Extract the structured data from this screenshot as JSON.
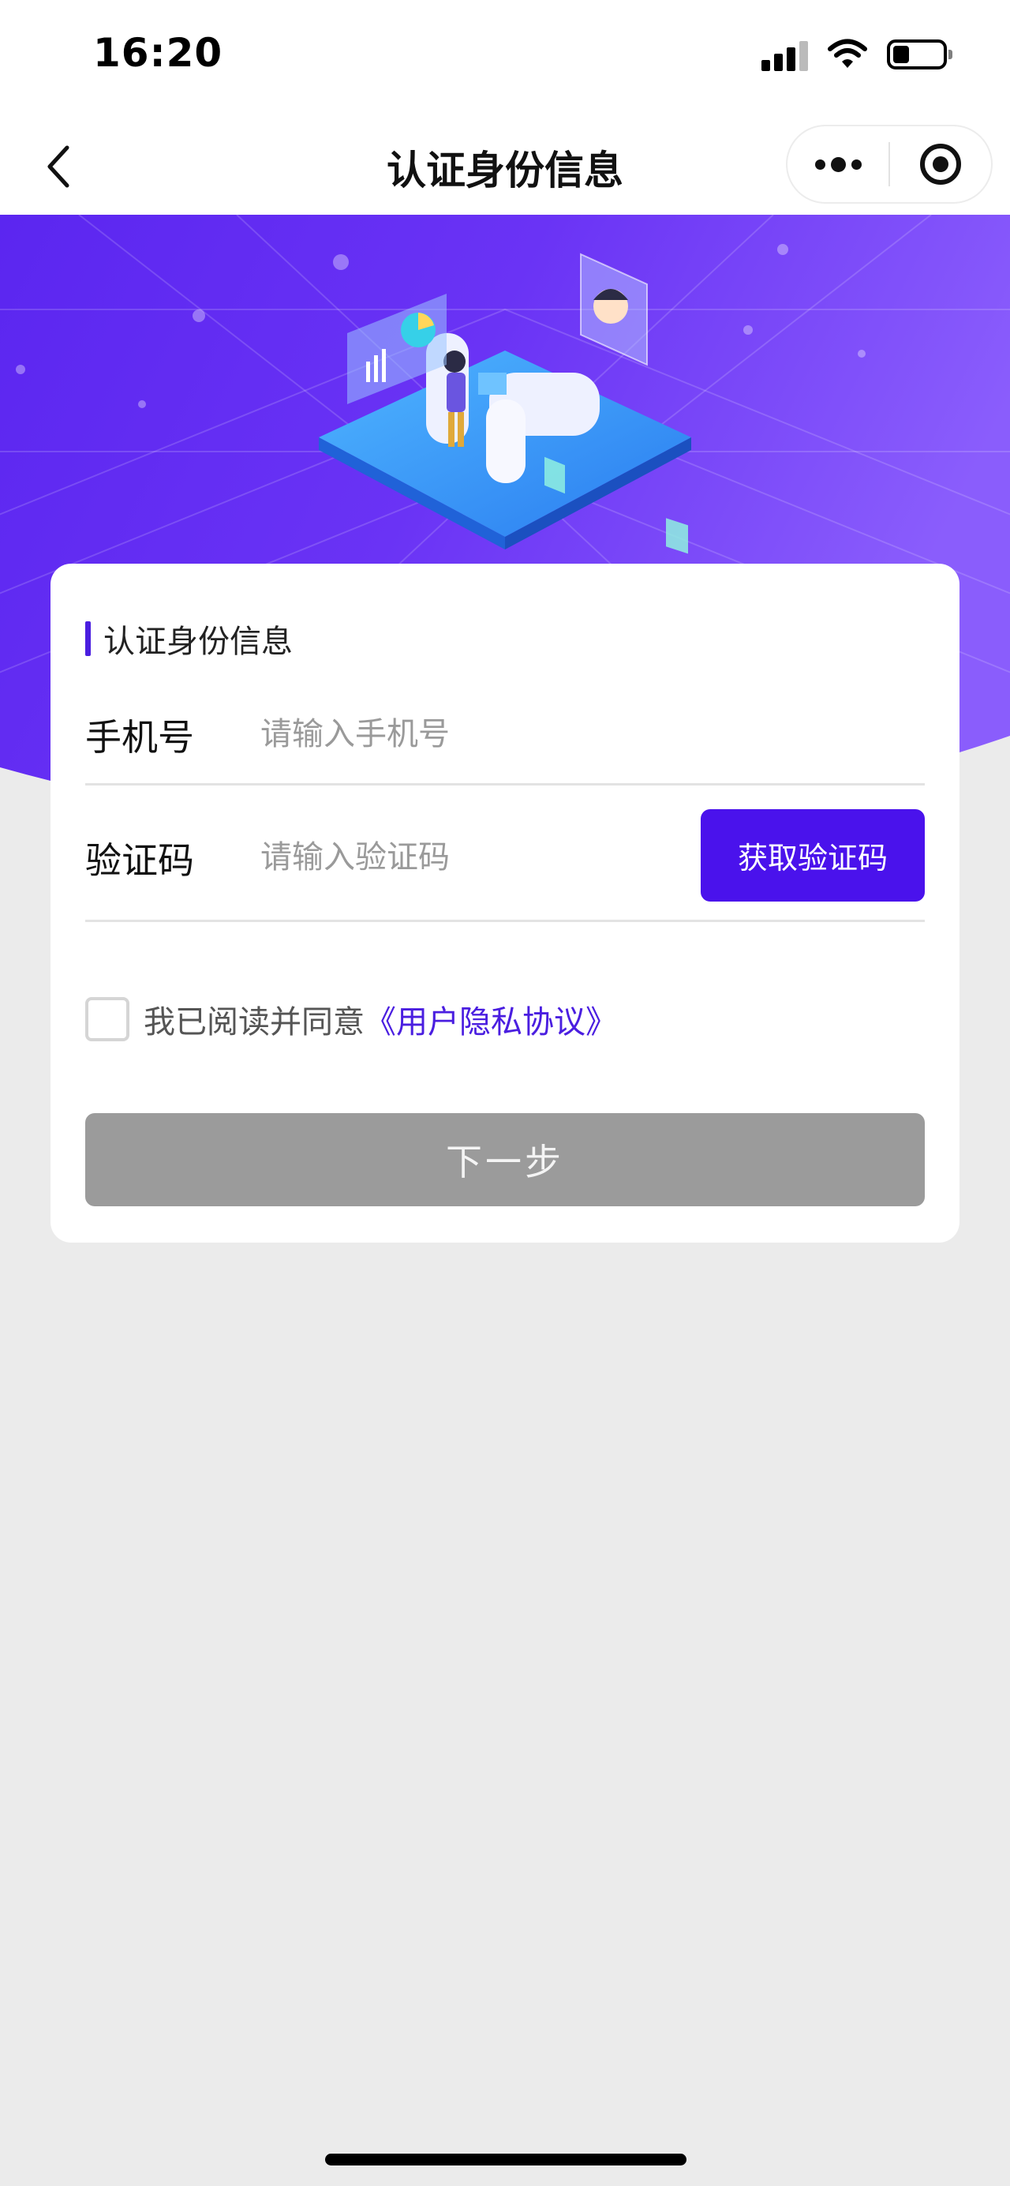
{
  "status_bar": {
    "time": "16:20",
    "icons": [
      "signal-icon",
      "wifi-icon",
      "battery-icon"
    ]
  },
  "nav": {
    "title": "认证身份信息",
    "back_icon": "chevron-left-icon",
    "more_icon": "more-dots-icon",
    "close_icon": "target-circle-icon"
  },
  "form": {
    "section_title": "认证身份信息",
    "phone_label": "手机号",
    "phone_placeholder": "请输入手机号",
    "code_label": "验证码",
    "code_placeholder": "请输入验证码",
    "get_code_label": "获取验证码",
    "agree_text": "我已阅读并同意",
    "agree_link": "《用户隐私协议》",
    "next_label": "下一步"
  },
  "colors": {
    "accent": "#4a12ec",
    "banner_gradient": [
      "#5b26f0",
      "#8a5dfc"
    ],
    "disabled_button": "#9b9b9b",
    "page_background": "#ebebeb"
  }
}
